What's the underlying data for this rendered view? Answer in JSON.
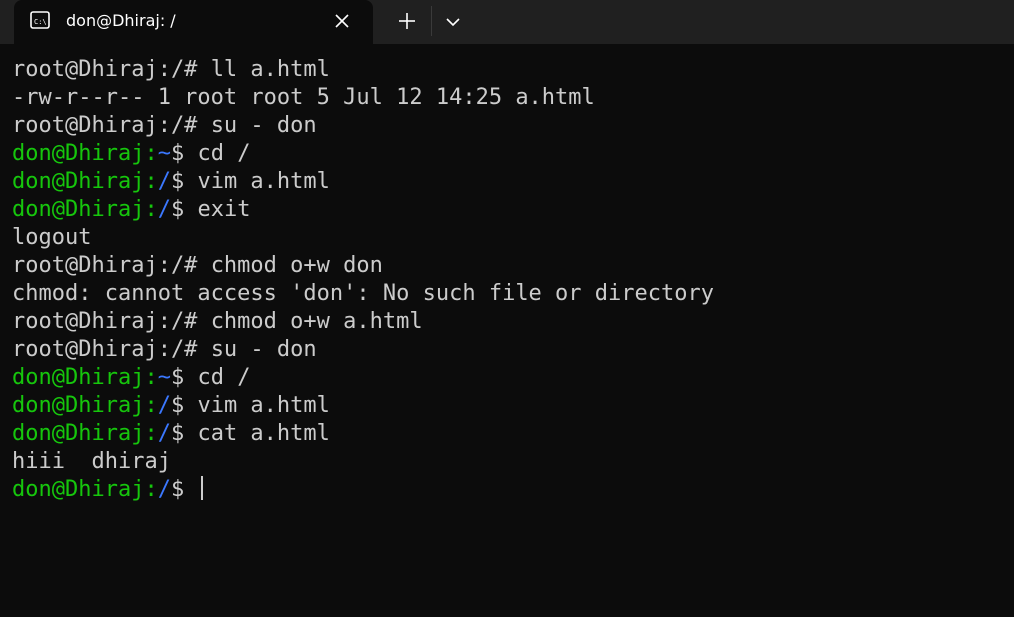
{
  "tab": {
    "title": "don@Dhiraj: /",
    "icon": "terminal-icon",
    "close_icon": "close-icon"
  },
  "titlebar": {
    "new_tab_icon": "plus-icon",
    "dropdown_icon": "chevron-down-icon"
  },
  "colors": {
    "background": "#0c0c0c",
    "titlebar": "#202020",
    "text": "#cccccc",
    "user": "#16c60c",
    "path": "#3b78ff"
  },
  "terminal": {
    "lines": [
      {
        "type": "root",
        "prompt": "root@Dhiraj:/# ",
        "cmd": "ll a.html"
      },
      {
        "type": "out",
        "text": "-rw-r--r-- 1 root root 5 Jul 12 14:25 a.html"
      },
      {
        "type": "root",
        "prompt": "root@Dhiraj:/# ",
        "cmd": "su - don"
      },
      {
        "type": "user",
        "user": "don@Dhiraj",
        "path": "~",
        "sym": "$ ",
        "cmd": "cd /"
      },
      {
        "type": "user",
        "user": "don@Dhiraj",
        "path": "/",
        "sym": "$ ",
        "cmd": "vim a.html"
      },
      {
        "type": "user",
        "user": "don@Dhiraj",
        "path": "/",
        "sym": "$ ",
        "cmd": "exit"
      },
      {
        "type": "out",
        "text": "logout"
      },
      {
        "type": "root",
        "prompt": "root@Dhiraj:/# ",
        "cmd": "chmod o+w don"
      },
      {
        "type": "out",
        "text": "chmod: cannot access 'don': No such file or directory"
      },
      {
        "type": "root",
        "prompt": "root@Dhiraj:/# ",
        "cmd": "chmod o+w a.html"
      },
      {
        "type": "root",
        "prompt": "root@Dhiraj:/# ",
        "cmd": "su - don"
      },
      {
        "type": "user",
        "user": "don@Dhiraj",
        "path": "~",
        "sym": "$ ",
        "cmd": "cd /"
      },
      {
        "type": "user",
        "user": "don@Dhiraj",
        "path": "/",
        "sym": "$ ",
        "cmd": "vim a.html"
      },
      {
        "type": "user",
        "user": "don@Dhiraj",
        "path": "/",
        "sym": "$ ",
        "cmd": "cat a.html"
      },
      {
        "type": "out",
        "text": "hiii  dhiraj"
      },
      {
        "type": "user",
        "user": "don@Dhiraj",
        "path": "/",
        "sym": "$ ",
        "cmd": "",
        "cursor": true
      }
    ]
  }
}
